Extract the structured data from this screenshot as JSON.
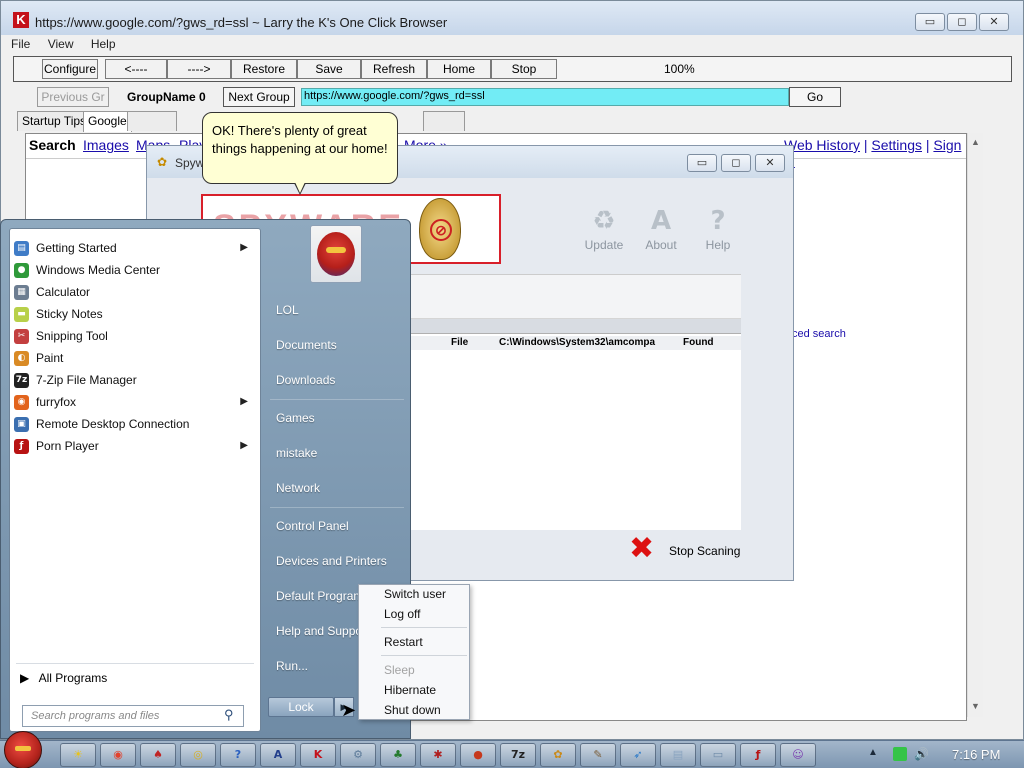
{
  "browser": {
    "title": "https://www.google.com/?gws_rd=ssl ~ Larry the K's One Click Browser",
    "logo_letter": "K",
    "window_controls": {
      "minimize": "▭",
      "restore": "◻",
      "close": "✕"
    },
    "menu": [
      "File",
      "View",
      "Help"
    ],
    "toolbar": {
      "configure": "Configure",
      "back": "<----",
      "forward": "---->",
      "restore": "Restore",
      "save": "Save",
      "refresh": "Refresh",
      "home": "Home",
      "stop": "Stop",
      "zoom": "100%"
    },
    "nav": {
      "previous_group": "Previous Gr",
      "group_name": "GroupName 0",
      "next_group": "Next Group",
      "url": "https://www.google.com/?gws_rd=ssl",
      "go": "Go"
    },
    "tabs": [
      "Startup Tips",
      "Google"
    ]
  },
  "google": {
    "search": "Search",
    "links": [
      "Images",
      "Maps",
      "Play",
      "More »"
    ],
    "right_links": [
      "Web History",
      "Settings",
      "Sign in"
    ],
    "advanced_search": "ced search"
  },
  "spyware": {
    "title": "Spyw",
    "tools": [
      {
        "label": "Update",
        "glyph": "♻"
      },
      {
        "label": "About",
        "glyph": "A"
      },
      {
        "label": "Help",
        "glyph": "?"
      }
    ],
    "row": {
      "type": "File",
      "path": "C:\\Windows\\System32\\amcompa",
      "status": "Found"
    },
    "stop_scanning": "Stop Scaning"
  },
  "bubble": {
    "text": "OK! There's plenty of great things happening at our home!"
  },
  "start_menu": {
    "programs": [
      {
        "label": "Getting Started",
        "has_submenu": true,
        "color": "#3f7cc7",
        "glyph": "▤"
      },
      {
        "label": "Windows Media Center",
        "has_submenu": false,
        "color": "#2f9a3a",
        "glyph": "●"
      },
      {
        "label": "Calculator",
        "has_submenu": false,
        "color": "#6c7d91",
        "glyph": "▦"
      },
      {
        "label": "Sticky Notes",
        "has_submenu": false,
        "color": "#b8d04a",
        "glyph": "▬"
      },
      {
        "label": "Snipping Tool",
        "has_submenu": false,
        "color": "#c33f3f",
        "glyph": "✂"
      },
      {
        "label": "Paint",
        "has_submenu": false,
        "color": "#d98a25",
        "glyph": "◐"
      },
      {
        "label": "7-Zip File Manager",
        "has_submenu": false,
        "color": "#222222",
        "glyph": "7z"
      },
      {
        "label": "furryfox",
        "has_submenu": true,
        "color": "#e2631c",
        "glyph": "◉"
      },
      {
        "label": "Remote Desktop Connection",
        "has_submenu": false,
        "color": "#3b6fb0",
        "glyph": "▣"
      },
      {
        "label": "Porn Player",
        "has_submenu": true,
        "color": "#b81313",
        "glyph": "ƒ"
      }
    ],
    "all_programs": "All Programs",
    "all_programs_arrow": "▶",
    "search_placeholder": "Search programs and files",
    "search_glyph": "⚲",
    "right_links": [
      "LOL",
      "Documents",
      "Downloads",
      "Games",
      "mistake",
      "Network",
      "Control Panel",
      "Devices and Printers",
      "Default Programs",
      "Help and Support",
      "Run..."
    ],
    "lock": "Lock",
    "lock_arrow": "▶",
    "cursor_glyph": "➤"
  },
  "power_menu": {
    "items": [
      {
        "label": "Switch user",
        "enabled": true
      },
      {
        "label": "Log off",
        "enabled": true
      },
      {
        "label": "Restart",
        "enabled": true
      },
      {
        "label": "Sleep",
        "enabled": false
      },
      {
        "label": "Hibernate",
        "enabled": true
      },
      {
        "label": "Shut down",
        "enabled": true
      }
    ]
  },
  "taskbar": {
    "apps": [
      {
        "name": "sun-app",
        "glyph": "☀",
        "color": "#e8c21a"
      },
      {
        "name": "chrome",
        "glyph": "◉",
        "color": "#e3412c"
      },
      {
        "name": "cards",
        "glyph": "♠",
        "color": "#c02424"
      },
      {
        "name": "cd-app",
        "glyph": "◎",
        "color": "#d8b020"
      },
      {
        "name": "help-app",
        "glyph": "?",
        "color": "#2a60c0"
      },
      {
        "name": "a-app",
        "glyph": "A",
        "color": "#233f8c"
      },
      {
        "name": "k-browser",
        "glyph": "K",
        "color": "#c4121b"
      },
      {
        "name": "gear-app",
        "glyph": "⚙",
        "color": "#5d7b9a"
      },
      {
        "name": "tree-app",
        "glyph": "♣",
        "color": "#247a2d"
      },
      {
        "name": "spider-app",
        "glyph": "✱",
        "color": "#b01e1e"
      },
      {
        "name": "ttb-app",
        "glyph": "●",
        "color": "#c6391d"
      },
      {
        "name": "zip-app",
        "glyph": "7z",
        "color": "#222222"
      },
      {
        "name": "bug-app",
        "glyph": "✿",
        "color": "#c98a1a"
      },
      {
        "name": "tools-app",
        "glyph": "✎",
        "color": "#7a5e3a"
      },
      {
        "name": "bird-app",
        "glyph": "➶",
        "color": "#2878c8"
      },
      {
        "name": "notes-app",
        "glyph": "▤",
        "color": "#8aa4c0"
      },
      {
        "name": "window-app",
        "glyph": "▭",
        "color": "#6e8aa8"
      },
      {
        "name": "flash-app",
        "glyph": "ƒ",
        "color": "#b81313"
      },
      {
        "name": "purple-app",
        "glyph": "☺",
        "color": "#7a3db0"
      }
    ],
    "tray_arrow": "▲",
    "clock": "7:16 PM"
  }
}
